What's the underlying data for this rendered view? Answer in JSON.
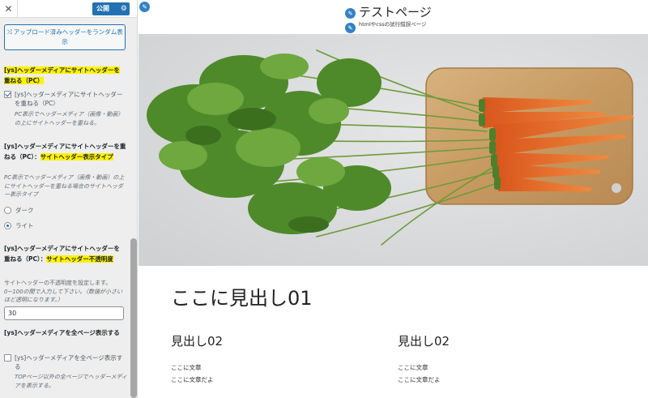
{
  "sidebar": {
    "close_icon": "close-icon",
    "publish_label": "公開",
    "random_button_label": "アップロード済みヘッダーをランダム表示",
    "overlay_section": {
      "title": "[ys]ヘッダーメディアにサイトヘッダーを重ねる（PC）",
      "checkbox_label": "[ys]ヘッダーメディアにサイトヘッダーを重ねる（PC）",
      "checked": true,
      "description": "PC表示でヘッダーメディア（画像・動画）の上にサイトヘッダーを重ねる。"
    },
    "type_section": {
      "title_prefix": "[ys]ヘッダーメディアにサイトヘッダーを重ねる（PC）：",
      "title_highlight": "サイトヘッダー表示タイプ",
      "description": "PC表示でヘッダーメディア（画像・動画）の上にサイトヘッダーを重ねる場合のサイトヘッダー表示タイプ",
      "options": [
        {
          "label": "ダーク",
          "selected": false
        },
        {
          "label": "ライト",
          "selected": true
        }
      ]
    },
    "opacity_section": {
      "title_prefix": "[ys]ヘッダーメディアにサイトヘッダーを重ねる（PC）：",
      "title_highlight": "サイトヘッダー不透明度",
      "description_line1": "サイトヘッダーの不透明度を設定します。",
      "description_line2": "0~100の間で入力して下さい。（数値が小さいほど透明になります。）",
      "value": "30"
    },
    "all_pages_section": {
      "title": "[ys]ヘッダーメディアを全ページ表示する",
      "checkbox_label": "[ys]ヘッダーメディアを全ページ表示する",
      "checked": false,
      "description": "TOPページ以外の全ページでヘッダーメディアを表示する。"
    }
  },
  "preview": {
    "site_title": "テストページ",
    "site_description": "htmlやcssの試行錯誤ページ",
    "main_heading": "ここに見出し01",
    "columns": [
      {
        "heading": "見出し02",
        "line1": "ここに文章",
        "line2": "ここに文章だよ"
      },
      {
        "heading": "見出し02",
        "line1": "ここに文章",
        "line2": "ここに文章だよ"
      }
    ]
  },
  "colors": {
    "accent": "#2271b1",
    "highlight": "#fff200",
    "pen": "#3582c4"
  }
}
